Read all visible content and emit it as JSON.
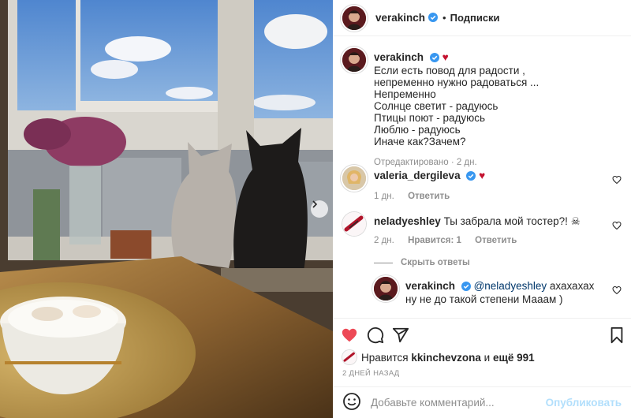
{
  "post": {
    "author": "verakinch",
    "follow_state": "Подписки",
    "separator": "•",
    "caption_lines": [
      "Если есть повод для радости ,",
      "непременно нужно радоваться ...",
      "Непременно",
      "Солнце светит - радуюсь",
      "Птицы поют - радуюсь",
      "Люблю - радуюсь",
      "Иначе как?Зачем?"
    ],
    "caption_emoji": "♥",
    "caption_meta": "Отредактировано · 2 дн."
  },
  "comments": [
    {
      "user": "valeria_dergileva",
      "emoji": "♥",
      "time": "1 дн.",
      "reply": "Ответить"
    },
    {
      "user": "neladyeshley",
      "text": "Ты забрала мой тостер?! ☠",
      "time": "2 дн.",
      "likes": "Нравится: 1",
      "reply": "Ответить",
      "toggle_replies": "Скрыть ответы"
    },
    {
      "user": "verakinch",
      "mention": "@neladyeshley",
      "text": " ахахахах ну не до такой степени Мааам )"
    }
  ],
  "likes": {
    "prefix": "Нравится",
    "user": "kkinchevzona",
    "and": "и",
    "others": "ещё 991"
  },
  "date": "2 ДНЕЙ НАЗАД",
  "composer": {
    "placeholder": "Добавьте комментарий...",
    "publish": "Опубликовать"
  },
  "colors": {
    "like_red": "#ed4956",
    "verified_blue": "#3897f0",
    "publish_disabled": "#b2dffc"
  },
  "icons": [
    "heart-icon",
    "comment-icon",
    "share-icon",
    "bookmark-icon",
    "smile-icon",
    "verified-icon",
    "chevron-right-icon"
  ]
}
